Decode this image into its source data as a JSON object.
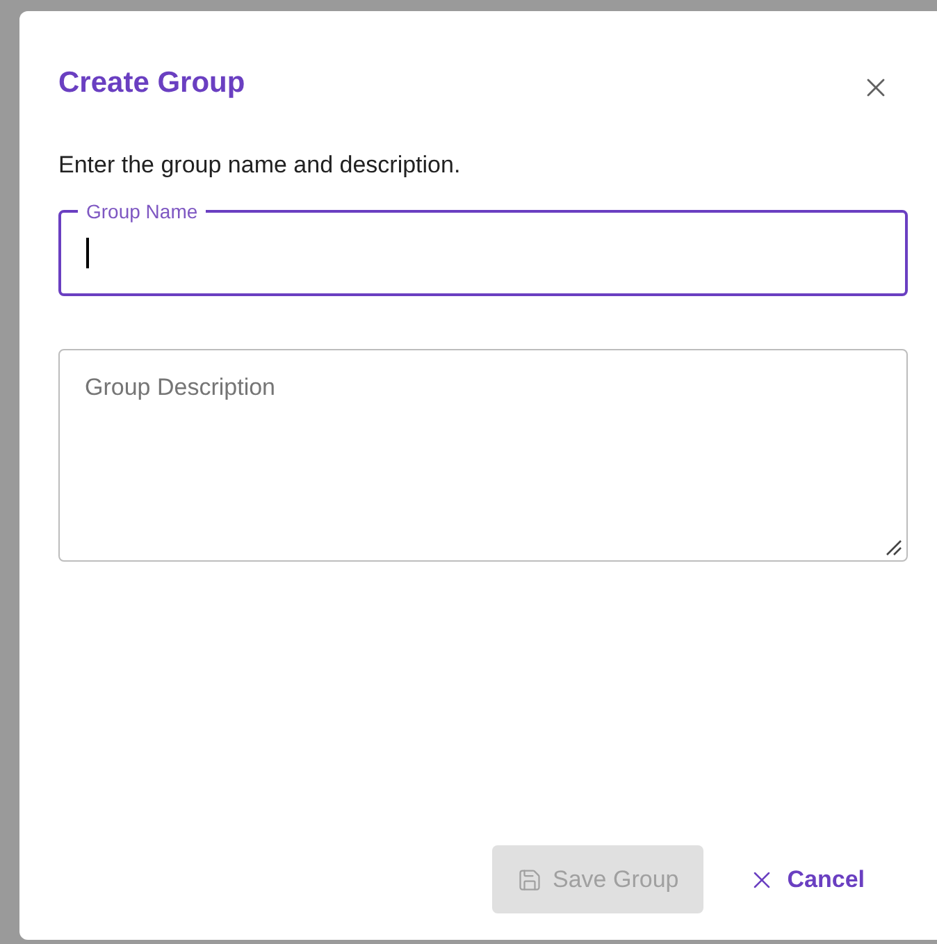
{
  "dialog": {
    "title": "Create Group",
    "description": "Enter the group name and description.",
    "fields": [
      {
        "kind": "text",
        "label": "Group Name",
        "focused": true
      },
      {
        "kind": "textarea",
        "placeholder": "Group Description",
        "focused": false
      }
    ],
    "buttons": [
      {
        "kind": "save",
        "label": "Save Group",
        "disabled": true
      },
      {
        "kind": "cancel",
        "label": "Cancel",
        "disabled": false
      }
    ]
  }
}
